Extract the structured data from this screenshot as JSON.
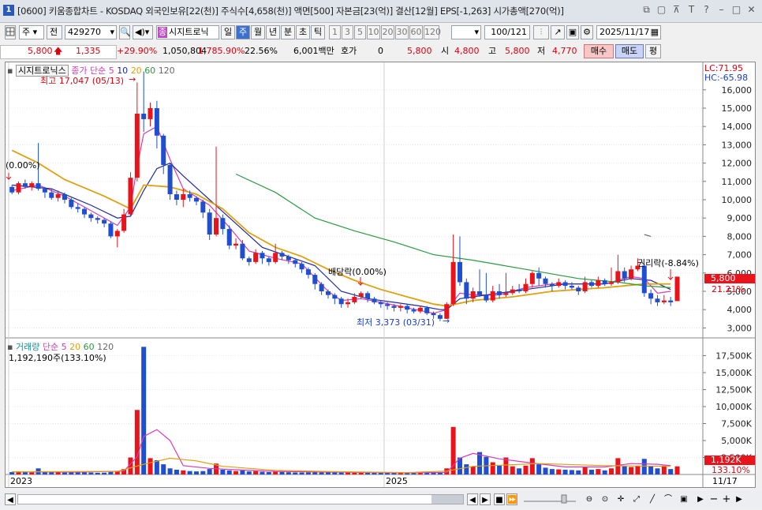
{
  "window": {
    "icon_label": "1",
    "title": "[0600] 키움종합차트 - KOSDAQ 외국인보유[22(천)] 주식수[4,658(천)] 액면[500] 자본금[23(억)] 결산[12월] EPS[-1,263] 시가총액[270(억)]",
    "controls": [
      "⧉",
      "▢",
      "⊼",
      "T",
      "?",
      "–",
      "□",
      "✕"
    ]
  },
  "toolbar": {
    "market": "주",
    "all": "전",
    "code": "429270",
    "sound_icon": "speaker-icon",
    "badge": "종",
    "name": "시지트로닉",
    "periods": [
      {
        "label": "일",
        "active": false
      },
      {
        "label": "주",
        "active": true
      },
      {
        "label": "월",
        "active": false
      },
      {
        "label": "년",
        "active": false
      },
      {
        "label": "분",
        "active": false
      },
      {
        "label": "초",
        "active": false
      },
      {
        "label": "틱",
        "active": false
      }
    ],
    "intervals": [
      "1",
      "3",
      "5",
      "10",
      "20",
      "30",
      "60",
      "120"
    ],
    "count": "100",
    "total": "/121",
    "date": "2025/11/17"
  },
  "quote": {
    "price": "5,800",
    "change": "1,335",
    "change_pct": "+29.90%",
    "volume": "1,050,804",
    "volume_pct": "1,785.90%",
    "turnover": "22.56%",
    "amount": "6,001백만",
    "hoga_label": "호가",
    "hoga_value": "0",
    "hoga_price": "5,800",
    "open_label": "시",
    "open": "4,800",
    "high_label": "고",
    "high": "5,800",
    "low_label": "저",
    "low": "4,770",
    "buy": "매수",
    "sell": "매도",
    "eval": "평"
  },
  "colors": {
    "up": "#e8131b",
    "down": "#1f4fd0",
    "ma5": "#d63bb8",
    "ma10": "#1d2a9e",
    "ma20": "#e0a010",
    "ma60": "#2a9a40",
    "ma120": "#666666"
  },
  "chart": {
    "price_legend": {
      "stock": "시지트로닉스",
      "label": "종가 단순",
      "ma": [
        "5",
        "10",
        "20",
        "60",
        "120"
      ]
    },
    "lc": "LC:71.95",
    "hc": "HC:-65.98",
    "annotations": {
      "high": "최고 17,047 (05/13)",
      "low": "최저 3,373 (03/31)",
      "dividend": "배당락(0.00%)",
      "left_pct": "(0.00%)",
      "rights": "권리락(-8.84%)"
    },
    "price_badge": "5,800",
    "price_badge_pct": "21.21%",
    "volume_legend": {
      "label": "거래량",
      "type": "단순",
      "ma": [
        "5",
        "20",
        "60",
        "120"
      ],
      "value": "1,192,190주(133.10%)"
    },
    "vol_badge": "1,192K",
    "vol_badge_pct": "133.10%",
    "x_labels": [
      {
        "label": "2023",
        "index": 0
      },
      {
        "label": "2025",
        "index": 57
      }
    ],
    "axis_date": "11/17"
  },
  "chart_data": {
    "type": "candlestick",
    "yticks": [
      3000,
      4000,
      5000,
      6000,
      7000,
      8000,
      9000,
      10000,
      11000,
      12000,
      13000,
      14000,
      15000,
      16000
    ],
    "ylim": [
      2500,
      17500
    ],
    "vol_yticks": [
      2500,
      5000,
      7500,
      10000,
      12500,
      15000,
      17500
    ],
    "vol_ylim": [
      0,
      20000
    ],
    "candles": [
      [
        10700,
        10400,
        10800,
        10300,
        350
      ],
      [
        10400,
        10900,
        11000,
        10300,
        450
      ],
      [
        10900,
        10700,
        11100,
        10600,
        380
      ],
      [
        10700,
        10900,
        11000,
        10500,
        300
      ],
      [
        10900,
        10600,
        13100,
        10500,
        900
      ],
      [
        10600,
        10400,
        10700,
        10100,
        420
      ],
      [
        10400,
        10100,
        10600,
        10000,
        360
      ],
      [
        10100,
        10300,
        10500,
        9900,
        300
      ],
      [
        10300,
        10000,
        10400,
        9800,
        280
      ],
      [
        10000,
        9600,
        10100,
        9500,
        350
      ],
      [
        9600,
        9500,
        9800,
        9300,
        300
      ],
      [
        9500,
        9200,
        9600,
        9000,
        330
      ],
      [
        9200,
        9000,
        9300,
        8800,
        280
      ],
      [
        9000,
        8900,
        9100,
        8700,
        250
      ],
      [
        8900,
        8700,
        9000,
        8500,
        270
      ],
      [
        8700,
        8000,
        8800,
        7900,
        400
      ],
      [
        8000,
        8300,
        8400,
        7400,
        450
      ],
      [
        8300,
        9200,
        9500,
        8200,
        800
      ],
      [
        9200,
        11200,
        11500,
        9100,
        2500
      ],
      [
        11200,
        14700,
        16400,
        11000,
        9500
      ],
      [
        14700,
        14400,
        17000,
        13700,
        18800
      ],
      [
        14400,
        15000,
        15300,
        14000,
        2400
      ],
      [
        15000,
        13500,
        15400,
        12800,
        2100
      ],
      [
        13500,
        11900,
        13600,
        11400,
        1500
      ],
      [
        11900,
        10300,
        12000,
        10000,
        900
      ],
      [
        10300,
        10000,
        10500,
        9700,
        700
      ],
      [
        10000,
        10300,
        10600,
        9600,
        600
      ],
      [
        10300,
        10100,
        10500,
        9900,
        500
      ],
      [
        10100,
        9900,
        10200,
        9700,
        450
      ],
      [
        9900,
        9300,
        10000,
        9000,
        500
      ],
      [
        9300,
        8100,
        9500,
        7800,
        800
      ],
      [
        8100,
        9000,
        12900,
        8000,
        1600
      ],
      [
        9000,
        8400,
        9200,
        8100,
        700
      ],
      [
        8400,
        7500,
        8600,
        7300,
        600
      ],
      [
        7500,
        7600,
        7900,
        7300,
        500
      ],
      [
        7600,
        6800,
        7800,
        6700,
        600
      ],
      [
        6800,
        6600,
        6900,
        6400,
        450
      ],
      [
        6600,
        7100,
        7300,
        6500,
        500
      ],
      [
        7100,
        6800,
        7200,
        6500,
        400
      ],
      [
        6800,
        6600,
        6900,
        6400,
        350
      ],
      [
        6600,
        7100,
        7600,
        6500,
        450
      ],
      [
        7100,
        6900,
        7200,
        6700,
        380
      ],
      [
        6900,
        6700,
        7000,
        6500,
        330
      ],
      [
        6700,
        6500,
        6800,
        6300,
        300
      ],
      [
        6500,
        6200,
        6600,
        6000,
        300
      ],
      [
        6200,
        5900,
        6300,
        5700,
        320
      ],
      [
        5900,
        5400,
        6000,
        5100,
        350
      ],
      [
        5400,
        5000,
        5500,
        4800,
        300
      ],
      [
        5000,
        4800,
        5100,
        4600,
        330
      ],
      [
        4800,
        4600,
        4900,
        4300,
        300
      ],
      [
        4600,
        4300,
        4700,
        4100,
        280
      ],
      [
        4300,
        4400,
        4600,
        4100,
        300
      ],
      [
        4400,
        4700,
        4900,
        4300,
        380
      ],
      [
        4700,
        4900,
        5000,
        4600,
        400
      ],
      [
        4900,
        4600,
        5000,
        4400,
        300
      ],
      [
        4600,
        4400,
        4700,
        4300,
        280
      ],
      [
        4400,
        4300,
        4500,
        4100,
        260
      ],
      [
        4300,
        4200,
        4400,
        4000,
        240
      ],
      [
        4200,
        4100,
        4300,
        3900,
        230
      ],
      [
        4100,
        4200,
        4300,
        3900,
        220
      ],
      [
        4200,
        4000,
        4300,
        3800,
        230
      ],
      [
        4000,
        3900,
        4100,
        3800,
        220
      ],
      [
        3900,
        4100,
        4200,
        3800,
        230
      ],
      [
        4100,
        3800,
        4200,
        3700,
        240
      ],
      [
        3800,
        3700,
        3900,
        3500,
        260
      ],
      [
        3700,
        3500,
        3800,
        3373,
        280
      ],
      [
        3500,
        4300,
        4400,
        3500,
        900
      ],
      [
        4300,
        6600,
        8100,
        4200,
        7000
      ],
      [
        6600,
        5500,
        8000,
        5300,
        2500
      ],
      [
        5500,
        4600,
        5700,
        4300,
        1500
      ],
      [
        4600,
        5000,
        5200,
        4400,
        1200
      ],
      [
        5000,
        4800,
        6200,
        4700,
        3300
      ],
      [
        4800,
        4500,
        6000,
        4400,
        2600
      ],
      [
        4500,
        5000,
        5300,
        4400,
        1800
      ],
      [
        5000,
        4800,
        5400,
        4600,
        1300
      ],
      [
        4800,
        4900,
        6000,
        4700,
        2500
      ],
      [
        4900,
        5100,
        5300,
        4800,
        1200
      ],
      [
        5100,
        5000,
        5400,
        4900,
        900
      ],
      [
        5000,
        5400,
        5700,
        4900,
        1300
      ],
      [
        5400,
        6000,
        6100,
        5200,
        2400
      ],
      [
        6000,
        5700,
        6300,
        5300,
        1500
      ],
      [
        5700,
        5400,
        5800,
        5200,
        1000
      ],
      [
        5400,
        5300,
        5500,
        5000,
        800
      ],
      [
        5300,
        5500,
        5700,
        5200,
        750
      ],
      [
        5500,
        5300,
        5600,
        5100,
        700
      ],
      [
        5300,
        5200,
        5500,
        5100,
        650
      ],
      [
        5200,
        5000,
        5300,
        4800,
        600
      ],
      [
        5000,
        5500,
        5800,
        4900,
        1100
      ],
      [
        5500,
        5300,
        5600,
        5200,
        700
      ],
      [
        5300,
        5600,
        5800,
        5200,
        800
      ],
      [
        5600,
        5400,
        5700,
        5300,
        600
      ],
      [
        5400,
        5500,
        6300,
        5300,
        900
      ],
      [
        5500,
        6100,
        7000,
        5400,
        2400
      ],
      [
        6100,
        5700,
        6300,
        5500,
        1200
      ],
      [
        5700,
        6200,
        6400,
        5600,
        1100
      ],
      [
        6200,
        6400,
        6800,
        6100,
        1300
      ],
      [
        6400,
        4900,
        6500,
        4700,
        2300
      ],
      [
        4900,
        4600,
        5100,
        4300,
        1200
      ],
      [
        4600,
        4400,
        4800,
        4200,
        900
      ],
      [
        4400,
        4500,
        4800,
        4300,
        1300
      ],
      [
        4500,
        4400,
        4700,
        4200,
        800
      ],
      [
        4465,
        5800,
        5800,
        4770,
        1192
      ]
    ],
    "avg_lines": {
      "ma5": [
        [
          0,
          10500
        ],
        [
          4,
          10800
        ],
        [
          8,
          10200
        ],
        [
          12,
          9400
        ],
        [
          16,
          8600
        ],
        [
          18,
          9600
        ],
        [
          19,
          11800
        ],
        [
          20,
          13600
        ],
        [
          22,
          14000
        ],
        [
          24,
          12200
        ],
        [
          26,
          10600
        ],
        [
          30,
          9700
        ],
        [
          33,
          8500
        ],
        [
          36,
          7200
        ],
        [
          40,
          6800
        ],
        [
          44,
          6500
        ],
        [
          48,
          5000
        ],
        [
          50,
          4500
        ],
        [
          53,
          4600
        ],
        [
          56,
          4400
        ],
        [
          60,
          4100
        ],
        [
          64,
          3800
        ],
        [
          66,
          4000
        ],
        [
          68,
          4900
        ],
        [
          70,
          4800
        ],
        [
          74,
          4800
        ],
        [
          78,
          5200
        ],
        [
          82,
          5400
        ],
        [
          86,
          5400
        ],
        [
          90,
          5400
        ],
        [
          94,
          5800
        ],
        [
          96,
          5700
        ],
        [
          98,
          4900
        ],
        [
          100,
          5000
        ]
      ],
      "ma10": [
        [
          0,
          10800
        ],
        [
          6,
          10600
        ],
        [
          12,
          9700
        ],
        [
          16,
          9000
        ],
        [
          18,
          9100
        ],
        [
          20,
          10500
        ],
        [
          22,
          11700
        ],
        [
          24,
          12000
        ],
        [
          26,
          11300
        ],
        [
          30,
          10000
        ],
        [
          34,
          8700
        ],
        [
          38,
          7400
        ],
        [
          42,
          6900
        ],
        [
          46,
          6400
        ],
        [
          50,
          5000
        ],
        [
          54,
          4600
        ],
        [
          58,
          4400
        ],
        [
          62,
          4200
        ],
        [
          65,
          4000
        ],
        [
          66,
          4000
        ],
        [
          68,
          4600
        ],
        [
          72,
          4800
        ],
        [
          78,
          5100
        ],
        [
          84,
          5400
        ],
        [
          90,
          5400
        ],
        [
          94,
          5700
        ],
        [
          97,
          5600
        ],
        [
          100,
          5100
        ]
      ],
      "ma20": [
        [
          0,
          12700
        ],
        [
          4,
          12000
        ],
        [
          8,
          11100
        ],
        [
          14,
          10200
        ],
        [
          18,
          9500
        ],
        [
          20,
          10800
        ],
        [
          24,
          10700
        ],
        [
          28,
          10300
        ],
        [
          32,
          9500
        ],
        [
          36,
          8200
        ],
        [
          40,
          7400
        ],
        [
          44,
          6900
        ],
        [
          48,
          6200
        ],
        [
          52,
          5600
        ],
        [
          56,
          5100
        ],
        [
          60,
          4700
        ],
        [
          64,
          4300
        ],
        [
          66,
          4200
        ],
        [
          70,
          4500
        ],
        [
          76,
          4700
        ],
        [
          82,
          5000
        ],
        [
          90,
          5200
        ],
        [
          96,
          5400
        ],
        [
          100,
          5400
        ]
      ],
      "ma60": [
        [
          34,
          11400
        ],
        [
          40,
          10400
        ],
        [
          46,
          9000
        ],
        [
          52,
          8300
        ],
        [
          58,
          7700
        ],
        [
          64,
          7000
        ],
        [
          70,
          6700
        ],
        [
          78,
          6200
        ],
        [
          86,
          5700
        ],
        [
          92,
          5500
        ],
        [
          96,
          5300
        ],
        [
          100,
          5200
        ]
      ],
      "ma120": [
        [
          96,
          8100
        ],
        [
          97,
          8000
        ]
      ]
    },
    "vol_ma5": [
      [
        0,
        400
      ],
      [
        10,
        350
      ],
      [
        17,
        500
      ],
      [
        19,
        2600
      ],
      [
        20,
        5600
      ],
      [
        22,
        6600
      ],
      [
        24,
        5000
      ],
      [
        26,
        1300
      ],
      [
        30,
        900
      ],
      [
        34,
        700
      ],
      [
        40,
        450
      ],
      [
        50,
        320
      ],
      [
        60,
        240
      ],
      [
        66,
        300
      ],
      [
        68,
        2400
      ],
      [
        70,
        3100
      ],
      [
        74,
        2300
      ],
      [
        78,
        1800
      ],
      [
        84,
        1100
      ],
      [
        90,
        1100
      ],
      [
        94,
        1600
      ],
      [
        98,
        1500
      ],
      [
        100,
        1300
      ]
    ],
    "vol_ma20": [
      [
        0,
        400
      ],
      [
        16,
        450
      ],
      [
        20,
        1500
      ],
      [
        24,
        2400
      ],
      [
        28,
        2000
      ],
      [
        32,
        1200
      ],
      [
        40,
        600
      ],
      [
        50,
        400
      ],
      [
        60,
        280
      ],
      [
        66,
        500
      ],
      [
        70,
        1200
      ],
      [
        80,
        1600
      ],
      [
        90,
        1300
      ],
      [
        100,
        1200
      ]
    ]
  }
}
